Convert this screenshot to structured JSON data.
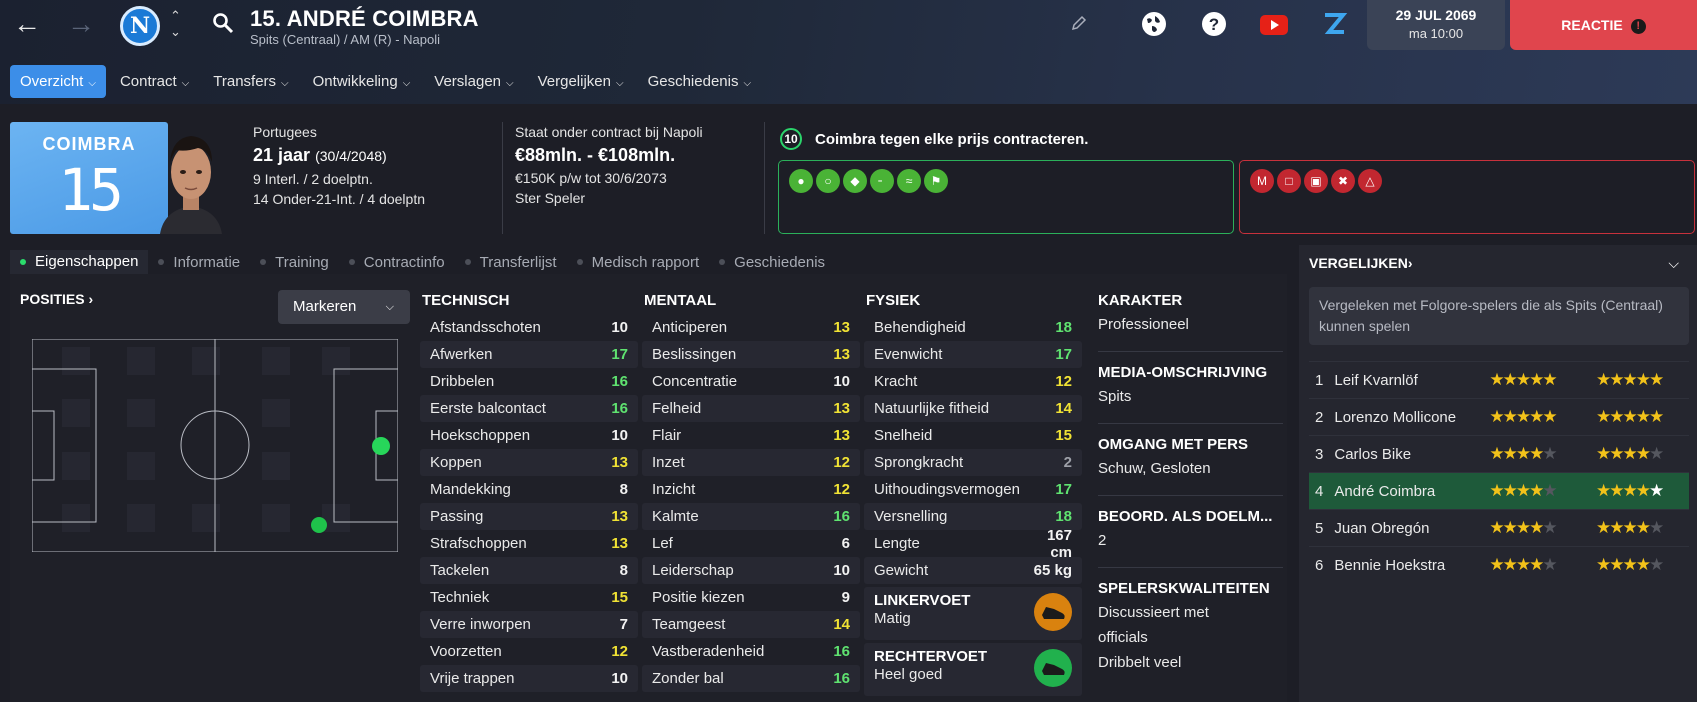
{
  "header": {
    "title": "15. ANDRÉ COIMBRA",
    "subtitle": "Spits (Centraal) / AM (R) - Napoli",
    "club_badge_letter": "N",
    "date": "29 JUL 2069",
    "time": "ma 10:00",
    "reactie_label": "REACTIE"
  },
  "menu": [
    {
      "label": "Overzicht",
      "active": true
    },
    {
      "label": "Contract"
    },
    {
      "label": "Transfers"
    },
    {
      "label": "Ontwikkeling"
    },
    {
      "label": "Verslagen"
    },
    {
      "label": "Vergelijken"
    },
    {
      "label": "Geschiedenis"
    }
  ],
  "shirt": {
    "name": "COIMBRA",
    "number": "15"
  },
  "bio": {
    "nationality": "Portugees",
    "age": "21 jaar",
    "dob": "(30/4/2048)",
    "caps": "9 Interl. / 2 doelptn.",
    "u21": "14 Onder-21-Int. / 4 doelptn"
  },
  "contract": {
    "status": "Staat onder contract bij Napoli",
    "value": "€88mln. - €108mln.",
    "wage": "€150K p/w tot 30/6/2073",
    "role": "Ster Speler",
    "badge": "10",
    "headline": "Coimbra tegen elke prijs contracteren."
  },
  "tabs": [
    {
      "label": "Eigenschappen",
      "active": true
    },
    {
      "label": "Informatie"
    },
    {
      "label": "Training"
    },
    {
      "label": "Contractinfo"
    },
    {
      "label": "Transferlijst"
    },
    {
      "label": "Medisch rapport"
    },
    {
      "label": "Geschiedenis"
    }
  ],
  "positions": {
    "title": "POSITIES",
    "markeren_label": "Markeren"
  },
  "attributes": {
    "technisch": {
      "title": "TECHNISCH",
      "rows": [
        {
          "name": "Afstandsschoten",
          "value": "10",
          "tone": "w"
        },
        {
          "name": "Afwerken",
          "value": "17",
          "tone": "gr"
        },
        {
          "name": "Dribbelen",
          "value": "16",
          "tone": "gr"
        },
        {
          "name": "Eerste balcontact",
          "value": "16",
          "tone": "gr"
        },
        {
          "name": "Hoekschoppen",
          "value": "10",
          "tone": "w"
        },
        {
          "name": "Koppen",
          "value": "13",
          "tone": "y"
        },
        {
          "name": "Mandekking",
          "value": "8",
          "tone": "w"
        },
        {
          "name": "Passing",
          "value": "13",
          "tone": "y"
        },
        {
          "name": "Strafschoppen",
          "value": "13",
          "tone": "y"
        },
        {
          "name": "Tackelen",
          "value": "8",
          "tone": "w"
        },
        {
          "name": "Techniek",
          "value": "15",
          "tone": "y"
        },
        {
          "name": "Verre inworpen",
          "value": "7",
          "tone": "w"
        },
        {
          "name": "Voorzetten",
          "value": "12",
          "tone": "y"
        },
        {
          "name": "Vrije trappen",
          "value": "10",
          "tone": "w"
        }
      ]
    },
    "mentaal": {
      "title": "MENTAAL",
      "rows": [
        {
          "name": "Anticiperen",
          "value": "13",
          "tone": "y"
        },
        {
          "name": "Beslissingen",
          "value": "13",
          "tone": "y"
        },
        {
          "name": "Concentratie",
          "value": "10",
          "tone": "w"
        },
        {
          "name": "Felheid",
          "value": "13",
          "tone": "y"
        },
        {
          "name": "Flair",
          "value": "13",
          "tone": "y"
        },
        {
          "name": "Inzet",
          "value": "12",
          "tone": "y"
        },
        {
          "name": "Inzicht",
          "value": "12",
          "tone": "y"
        },
        {
          "name": "Kalmte",
          "value": "16",
          "tone": "gr"
        },
        {
          "name": "Lef",
          "value": "6",
          "tone": "w"
        },
        {
          "name": "Leiderschap",
          "value": "10",
          "tone": "w"
        },
        {
          "name": "Positie kiezen",
          "value": "9",
          "tone": "w"
        },
        {
          "name": "Teamgeest",
          "value": "14",
          "tone": "y"
        },
        {
          "name": "Vastberadenheid",
          "value": "16",
          "tone": "gr"
        },
        {
          "name": "Zonder bal",
          "value": "16",
          "tone": "gr"
        }
      ]
    },
    "fysiek": {
      "title": "FYSIEK",
      "rows": [
        {
          "name": "Behendigheid",
          "value": "18",
          "tone": "gr"
        },
        {
          "name": "Evenwicht",
          "value": "17",
          "tone": "gr"
        },
        {
          "name": "Kracht",
          "value": "12",
          "tone": "y"
        },
        {
          "name": "Natuurlijke fitheid",
          "value": "14",
          "tone": "y"
        },
        {
          "name": "Snelheid",
          "value": "15",
          "tone": "y"
        },
        {
          "name": "Sprongkracht",
          "value": "2",
          "tone": "dim"
        },
        {
          "name": "Uithoudingsvermogen",
          "value": "17",
          "tone": "gr"
        },
        {
          "name": "Versnelling",
          "value": "18",
          "tone": "gr"
        },
        {
          "name": "Lengte",
          "value": "167 cm",
          "tone": "w"
        },
        {
          "name": "Gewicht",
          "value": "65 kg",
          "tone": "w"
        }
      ],
      "left_foot": {
        "title": "LINKERVOET",
        "value": "Matig",
        "color": "#d9820f"
      },
      "right_foot": {
        "title": "RECHTERVOET",
        "value": "Heel goed",
        "color": "#21b14d"
      }
    }
  },
  "karakter": [
    {
      "title": "KARAKTER",
      "value": "Professioneel"
    },
    {
      "title": "MEDIA-OMSCHRIJVING",
      "value": "Spits"
    },
    {
      "title": "OMGANG MET PERS",
      "value": "Schuw, Gesloten"
    },
    {
      "title": "BEOORD. ALS DOELM...",
      "value": "2"
    },
    {
      "title": "SPELERSKWALITEITEN",
      "values": [
        "Discussieert met",
        "officials",
        "Dribbelt veel"
      ]
    }
  ],
  "compare": {
    "title": "VERGELIJKEN",
    "note": "Vergeleken met Folgore-spelers die als Spits (Centraal) kunnen spelen",
    "players": [
      {
        "rank": "1",
        "name": "Leif Kvarnlöf",
        "current": 5,
        "potential": 5
      },
      {
        "rank": "2",
        "name": "Lorenzo Mollicone",
        "current": 5,
        "potential": 5
      },
      {
        "rank": "3",
        "name": "Carlos Bike",
        "current": 4,
        "potential": 4
      },
      {
        "rank": "4",
        "name": "André Coimbra",
        "current": 3.5,
        "potential": 5,
        "highlight": true
      },
      {
        "rank": "5",
        "name": "Juan Obregón",
        "current": 3.5,
        "potential": 4
      },
      {
        "rank": "6",
        "name": "Bennie Hoekstra",
        "current": 3.5,
        "potential": 3.5
      }
    ]
  },
  "colors": {
    "accent": "#3c8ee8",
    "reactie": "#e0454d",
    "positive": "#5fe270",
    "warning": "#f0e234"
  }
}
